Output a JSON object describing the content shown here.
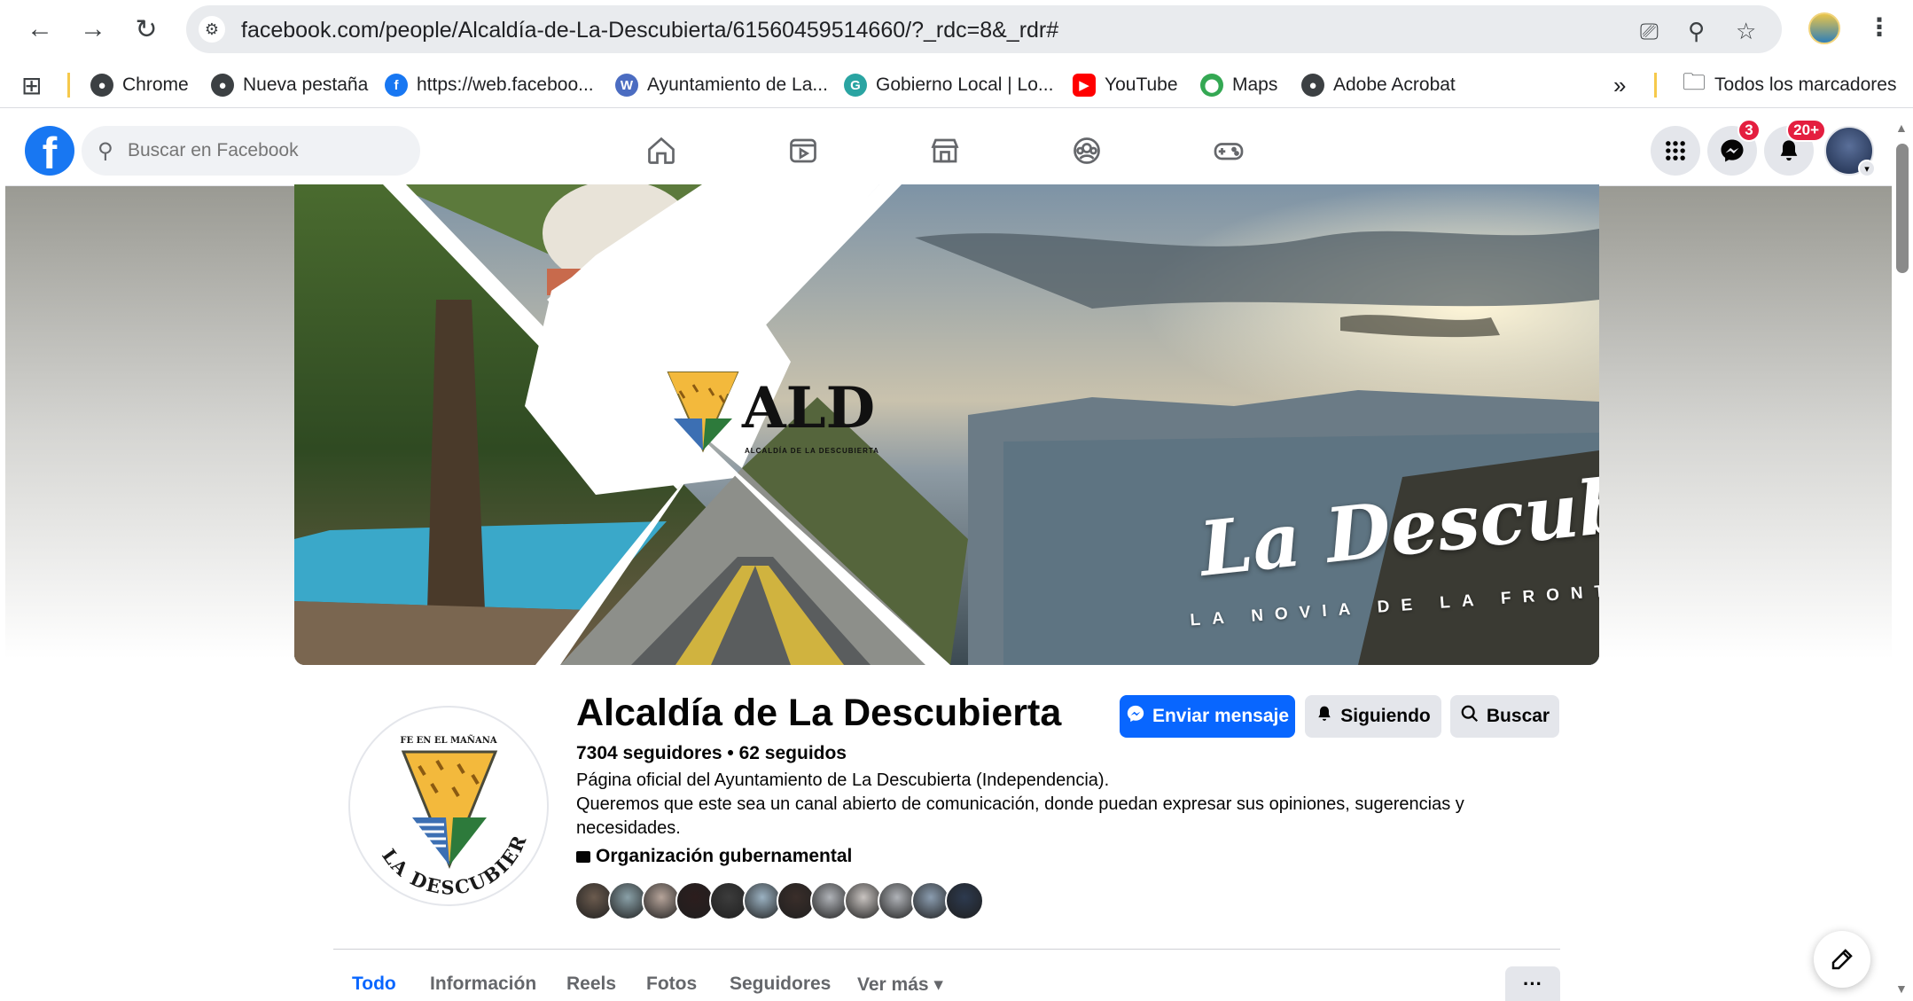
{
  "browser": {
    "url": "facebook.com/people/Alcaldía-de-La-Descubierta/61560459514660/?_rdc=8&_rdr#",
    "bookmarks": [
      {
        "label": "Chrome",
        "icon": "chrome-icon"
      },
      {
        "label": "Nueva pestaña",
        "icon": "chrome-icon"
      },
      {
        "label": "https://web.faceboo...",
        "icon": "facebook-icon"
      },
      {
        "label": "Ayuntamiento de La...",
        "icon": "wordpress-icon"
      },
      {
        "label": "Gobierno Local | Lo...",
        "icon": "gobierno-icon"
      },
      {
        "label": "YouTube",
        "icon": "youtube-icon"
      },
      {
        "label": "Maps",
        "icon": "maps-icon"
      },
      {
        "label": "Adobe Acrobat",
        "icon": "chrome-icon"
      }
    ],
    "overflow_label": "»",
    "all_bookmarks": "Todos los marcadores"
  },
  "fb": {
    "search_placeholder": "Buscar en Facebook",
    "messenger_badge": "3",
    "notifications_badge": "20+"
  },
  "cover": {
    "logo_text": "ALD",
    "logo_sub": "ALCALDÍA DE LA DESCUBIERTA",
    "title": "La Descubierta",
    "subtitle": "LA NOVIA DE LA FRONTERA"
  },
  "profile": {
    "motto": "FE EN EL MAÑANA",
    "ring_text": "LA DESCUBIERTA",
    "name": "Alcaldía de La Descubierta",
    "followers": "7304 seguidores • 62 seguidos",
    "description": [
      "Página oficial del Ayuntamiento de La Descubierta (Independencia).",
      "Queremos que este sea un canal abierto de comunicación, donde puedan expresar sus opiniones, sugerencias y",
      "necesidades."
    ],
    "category": "Organización gubernamental",
    "friend_colors": [
      "#6b5b4e",
      "#8aa1a8",
      "#b6a49a",
      "#2c1d1d",
      "#3c3c3c",
      "#9bb2c2",
      "#3a2e2a",
      "#b0b3b8",
      "#c9c4c1",
      "#b0b3b8",
      "#8b9db0",
      "#2d3a4f"
    ]
  },
  "actions": {
    "message": "Enviar mensaje",
    "following": "Siguiendo",
    "search": "Buscar"
  },
  "tabs": [
    "Todo",
    "Información",
    "Reels",
    "Fotos",
    "Seguidores",
    "Ver más ▾"
  ],
  "tabs_more": "···"
}
